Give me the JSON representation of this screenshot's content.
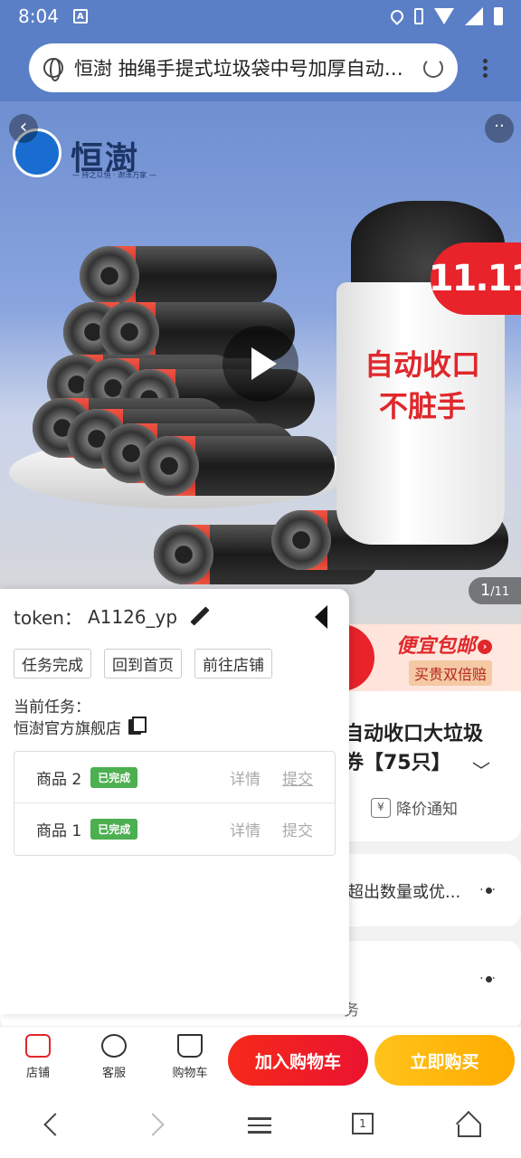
{
  "status_bar": {
    "time": "8:04",
    "a_icon": "A"
  },
  "address_bar": {
    "title": "恒澍 抽绳手提式垃圾袋中号加厚自动收口大垃圾袋"
  },
  "hero": {
    "brand_name": "恒澍",
    "brand_pinyin": "Shù",
    "brand_sub": "— 持之以恒 · 澍泽万家 —",
    "bin_text": "自动收口\n不脏手",
    "badge": "11.11",
    "counter_current": "1",
    "counter_total": "/11"
  },
  "promo": {
    "main": "便宜包邮",
    "sub": "买贵双倍赔"
  },
  "product": {
    "title_line1": "自动收口大垃圾",
    "title_line2": "券【75只】",
    "price_notify": "降价通知",
    "coupon_text": "超出数量或优...",
    "service_text": "务"
  },
  "panel": {
    "token_label": "token：",
    "token_value": "A1126_yp",
    "buttons": [
      "任务完成",
      "回到首页",
      "前往店铺"
    ],
    "task_label": "当前任务：",
    "task_shop": "恒澍官方旗舰店",
    "tasks": [
      {
        "name": "商品 2",
        "status": "已完成",
        "detail": "详情",
        "submit": "提交"
      },
      {
        "name": "商品 1",
        "status": "已完成",
        "detail": "详情",
        "submit": "提交"
      }
    ]
  },
  "action_bar": {
    "shop": "店铺",
    "service": "客服",
    "cart": "购物车",
    "add_to_cart": "加入购物车",
    "buy_now": "立即购买"
  },
  "nav": {
    "tabs_count": "1"
  }
}
